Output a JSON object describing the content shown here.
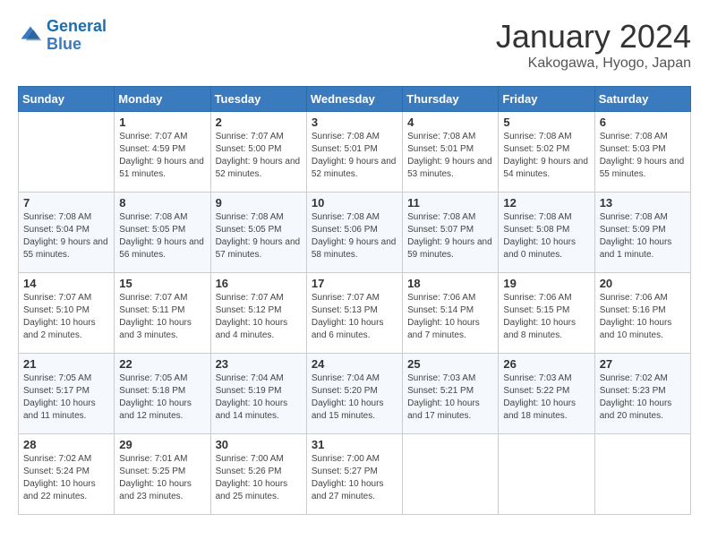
{
  "header": {
    "logo_line1": "General",
    "logo_line2": "Blue",
    "month": "January 2024",
    "location": "Kakogawa, Hyogo, Japan"
  },
  "weekdays": [
    "Sunday",
    "Monday",
    "Tuesday",
    "Wednesday",
    "Thursday",
    "Friday",
    "Saturday"
  ],
  "weeks": [
    [
      {
        "day": "",
        "sunrise": "",
        "sunset": "",
        "daylight": ""
      },
      {
        "day": "1",
        "sunrise": "Sunrise: 7:07 AM",
        "sunset": "Sunset: 4:59 PM",
        "daylight": "Daylight: 9 hours and 51 minutes."
      },
      {
        "day": "2",
        "sunrise": "Sunrise: 7:07 AM",
        "sunset": "Sunset: 5:00 PM",
        "daylight": "Daylight: 9 hours and 52 minutes."
      },
      {
        "day": "3",
        "sunrise": "Sunrise: 7:08 AM",
        "sunset": "Sunset: 5:01 PM",
        "daylight": "Daylight: 9 hours and 52 minutes."
      },
      {
        "day": "4",
        "sunrise": "Sunrise: 7:08 AM",
        "sunset": "Sunset: 5:01 PM",
        "daylight": "Daylight: 9 hours and 53 minutes."
      },
      {
        "day": "5",
        "sunrise": "Sunrise: 7:08 AM",
        "sunset": "Sunset: 5:02 PM",
        "daylight": "Daylight: 9 hours and 54 minutes."
      },
      {
        "day": "6",
        "sunrise": "Sunrise: 7:08 AM",
        "sunset": "Sunset: 5:03 PM",
        "daylight": "Daylight: 9 hours and 55 minutes."
      }
    ],
    [
      {
        "day": "7",
        "sunrise": "Sunrise: 7:08 AM",
        "sunset": "Sunset: 5:04 PM",
        "daylight": "Daylight: 9 hours and 55 minutes."
      },
      {
        "day": "8",
        "sunrise": "Sunrise: 7:08 AM",
        "sunset": "Sunset: 5:05 PM",
        "daylight": "Daylight: 9 hours and 56 minutes."
      },
      {
        "day": "9",
        "sunrise": "Sunrise: 7:08 AM",
        "sunset": "Sunset: 5:05 PM",
        "daylight": "Daylight: 9 hours and 57 minutes."
      },
      {
        "day": "10",
        "sunrise": "Sunrise: 7:08 AM",
        "sunset": "Sunset: 5:06 PM",
        "daylight": "Daylight: 9 hours and 58 minutes."
      },
      {
        "day": "11",
        "sunrise": "Sunrise: 7:08 AM",
        "sunset": "Sunset: 5:07 PM",
        "daylight": "Daylight: 9 hours and 59 minutes."
      },
      {
        "day": "12",
        "sunrise": "Sunrise: 7:08 AM",
        "sunset": "Sunset: 5:08 PM",
        "daylight": "Daylight: 10 hours and 0 minutes."
      },
      {
        "day": "13",
        "sunrise": "Sunrise: 7:08 AM",
        "sunset": "Sunset: 5:09 PM",
        "daylight": "Daylight: 10 hours and 1 minute."
      }
    ],
    [
      {
        "day": "14",
        "sunrise": "Sunrise: 7:07 AM",
        "sunset": "Sunset: 5:10 PM",
        "daylight": "Daylight: 10 hours and 2 minutes."
      },
      {
        "day": "15",
        "sunrise": "Sunrise: 7:07 AM",
        "sunset": "Sunset: 5:11 PM",
        "daylight": "Daylight: 10 hours and 3 minutes."
      },
      {
        "day": "16",
        "sunrise": "Sunrise: 7:07 AM",
        "sunset": "Sunset: 5:12 PM",
        "daylight": "Daylight: 10 hours and 4 minutes."
      },
      {
        "day": "17",
        "sunrise": "Sunrise: 7:07 AM",
        "sunset": "Sunset: 5:13 PM",
        "daylight": "Daylight: 10 hours and 6 minutes."
      },
      {
        "day": "18",
        "sunrise": "Sunrise: 7:06 AM",
        "sunset": "Sunset: 5:14 PM",
        "daylight": "Daylight: 10 hours and 7 minutes."
      },
      {
        "day": "19",
        "sunrise": "Sunrise: 7:06 AM",
        "sunset": "Sunset: 5:15 PM",
        "daylight": "Daylight: 10 hours and 8 minutes."
      },
      {
        "day": "20",
        "sunrise": "Sunrise: 7:06 AM",
        "sunset": "Sunset: 5:16 PM",
        "daylight": "Daylight: 10 hours and 10 minutes."
      }
    ],
    [
      {
        "day": "21",
        "sunrise": "Sunrise: 7:05 AM",
        "sunset": "Sunset: 5:17 PM",
        "daylight": "Daylight: 10 hours and 11 minutes."
      },
      {
        "day": "22",
        "sunrise": "Sunrise: 7:05 AM",
        "sunset": "Sunset: 5:18 PM",
        "daylight": "Daylight: 10 hours and 12 minutes."
      },
      {
        "day": "23",
        "sunrise": "Sunrise: 7:04 AM",
        "sunset": "Sunset: 5:19 PM",
        "daylight": "Daylight: 10 hours and 14 minutes."
      },
      {
        "day": "24",
        "sunrise": "Sunrise: 7:04 AM",
        "sunset": "Sunset: 5:20 PM",
        "daylight": "Daylight: 10 hours and 15 minutes."
      },
      {
        "day": "25",
        "sunrise": "Sunrise: 7:03 AM",
        "sunset": "Sunset: 5:21 PM",
        "daylight": "Daylight: 10 hours and 17 minutes."
      },
      {
        "day": "26",
        "sunrise": "Sunrise: 7:03 AM",
        "sunset": "Sunset: 5:22 PM",
        "daylight": "Daylight: 10 hours and 18 minutes."
      },
      {
        "day": "27",
        "sunrise": "Sunrise: 7:02 AM",
        "sunset": "Sunset: 5:23 PM",
        "daylight": "Daylight: 10 hours and 20 minutes."
      }
    ],
    [
      {
        "day": "28",
        "sunrise": "Sunrise: 7:02 AM",
        "sunset": "Sunset: 5:24 PM",
        "daylight": "Daylight: 10 hours and 22 minutes."
      },
      {
        "day": "29",
        "sunrise": "Sunrise: 7:01 AM",
        "sunset": "Sunset: 5:25 PM",
        "daylight": "Daylight: 10 hours and 23 minutes."
      },
      {
        "day": "30",
        "sunrise": "Sunrise: 7:00 AM",
        "sunset": "Sunset: 5:26 PM",
        "daylight": "Daylight: 10 hours and 25 minutes."
      },
      {
        "day": "31",
        "sunrise": "Sunrise: 7:00 AM",
        "sunset": "Sunset: 5:27 PM",
        "daylight": "Daylight: 10 hours and 27 minutes."
      },
      {
        "day": "",
        "sunrise": "",
        "sunset": "",
        "daylight": ""
      },
      {
        "day": "",
        "sunrise": "",
        "sunset": "",
        "daylight": ""
      },
      {
        "day": "",
        "sunrise": "",
        "sunset": "",
        "daylight": ""
      }
    ]
  ]
}
